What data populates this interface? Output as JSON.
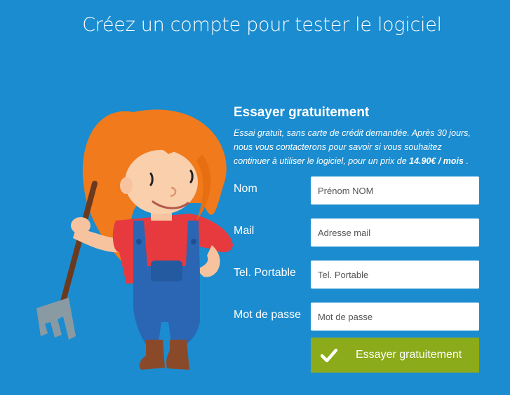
{
  "header": {
    "title": "Créez un compte pour tester le logiciel"
  },
  "form": {
    "heading": "Essayer gratuitement",
    "description_prefix": "Essai gratuit, sans carte de crédit demandée. Après 30 jours, nous vous contacterons pour savoir si vous souhaitez continuer à utiliser le logiciel, pour un prix de",
    "price": "14.90€ / mois",
    "description_suffix": ".",
    "fields": [
      {
        "label": "Nom",
        "placeholder": "Prénom NOM",
        "value": ""
      },
      {
        "label": "Mail",
        "placeholder": "Adresse mail",
        "value": ""
      },
      {
        "label": "Tel. Portable",
        "placeholder": "Tel. Portable",
        "value": ""
      },
      {
        "label": "Mot de passe",
        "placeholder": "Mot de passe",
        "value": ""
      }
    ],
    "submit_label": "Essayer gratuitement"
  },
  "colors": {
    "background": "#1b8ccf",
    "button": "#8bab1a",
    "hair": "#f47b20",
    "overalls": "#2a66b3",
    "shirt": "#e63a3f"
  },
  "icons": {
    "submit": "check-icon",
    "illustration": "farmer-girl-with-pitchfork"
  }
}
